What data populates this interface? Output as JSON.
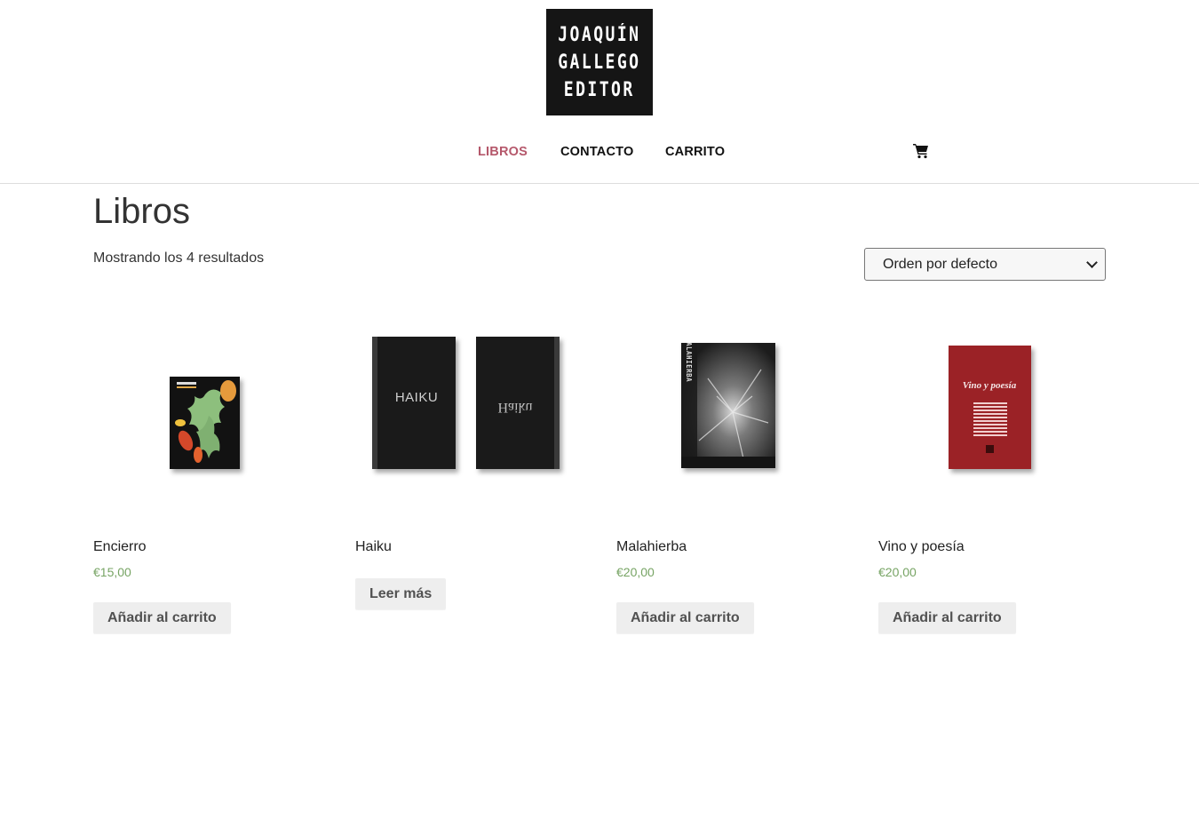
{
  "logo": {
    "line1": "JOAQUÍN",
    "line2": "GALLEGO",
    "line3": "EDITOR"
  },
  "nav": {
    "items": [
      "LIBROS",
      "CONTACTO",
      "CARRITO"
    ],
    "active": "LIBROS",
    "active_color": "#b5586b",
    "cart_icon": "shopping-cart-icon"
  },
  "shop": {
    "title": "Libros",
    "result_count": "Mostrando los 4 resultados",
    "orderby": {
      "selected": "Orden por defecto"
    }
  },
  "products": [
    {
      "title": "Encierro",
      "price": "€15,00",
      "button": "Añadir al carrito"
    },
    {
      "title": "Haiku",
      "price": "",
      "button": "Leer más",
      "cover_texts": [
        "HAIKU",
        "Haiku"
      ]
    },
    {
      "title": "Malahierba",
      "price": "€20,00",
      "button": "Añadir al carrito",
      "cover_text": "MALAHIERBA"
    },
    {
      "title": "Vino y poesía",
      "price": "€20,00",
      "button": "Añadir al carrito",
      "cover_text": "Vino y poesía"
    }
  ],
  "colors": {
    "price": "#77a464",
    "button_bg": "#eeeeee",
    "button_text": "#515151",
    "logo_bg": "#151515",
    "vino_cover": "#9b2226"
  }
}
